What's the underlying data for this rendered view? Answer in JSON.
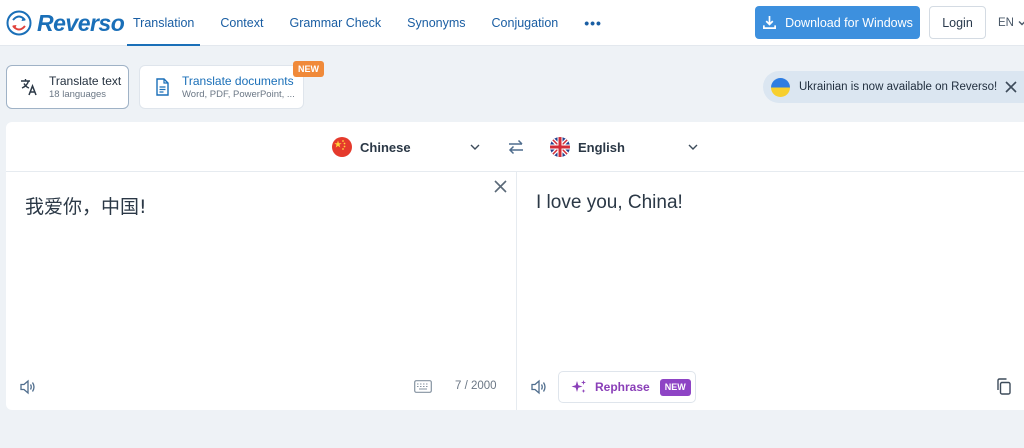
{
  "brand": {
    "name": "Reverso"
  },
  "nav": {
    "items": [
      {
        "label": "Translation",
        "active": true
      },
      {
        "label": "Context"
      },
      {
        "label": "Grammar Check"
      },
      {
        "label": "Synonyms"
      },
      {
        "label": "Conjugation"
      }
    ],
    "more_label": "•••"
  },
  "header": {
    "download_label": "Download for Windows",
    "login_label": "Login",
    "ui_language": "EN"
  },
  "modes": {
    "text": {
      "title": "Translate text",
      "subtitle": "18 languages"
    },
    "documents": {
      "title": "Translate documents",
      "subtitle": "Word, PDF, PowerPoint, ...",
      "badge": "NEW"
    }
  },
  "notice": {
    "text": "Ukrainian is now available on Reverso!"
  },
  "translator": {
    "source_language": "Chinese",
    "target_language": "English",
    "source_text": "我爱你，中国!",
    "target_text": "I love you, China!",
    "char_count": "7 / 2000",
    "rephrase_label": "Rephrase",
    "rephrase_badge": "NEW"
  },
  "colors": {
    "brand_blue": "#1a6fb8",
    "download_bg": "#3d90de",
    "new_orange": "#f08a3a",
    "rephrase_purple": "#8e44c5"
  }
}
